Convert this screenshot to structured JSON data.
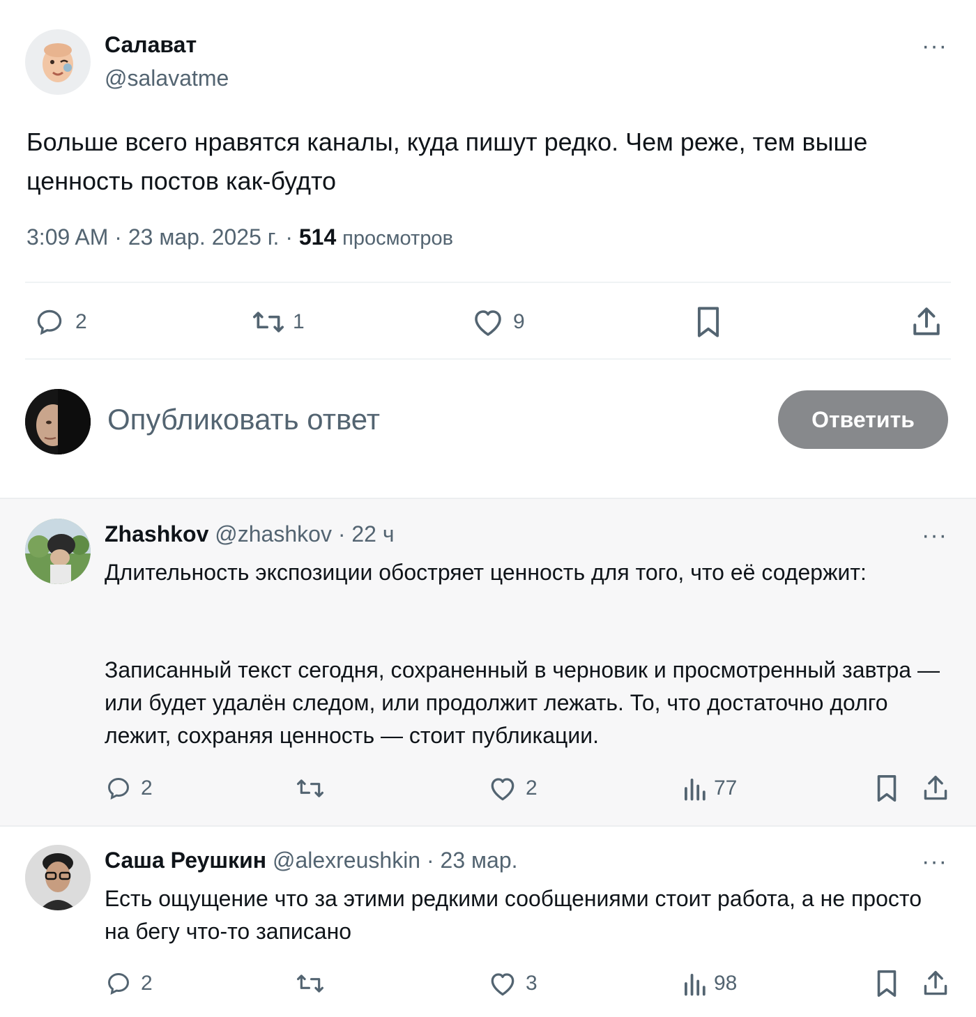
{
  "main_post": {
    "author_name": "Салават",
    "author_handle": "@salavatme",
    "text": "Больше всего нравятся каналы, куда пишут редко. Чем реже, тем выше ценность постов как-будто",
    "time": "3:09 AM · 23 мар. 2025 г. · ",
    "views_count": "514",
    "views_label": "просмотров",
    "actions": {
      "replies": "2",
      "reposts": "1",
      "likes": "9"
    }
  },
  "compose": {
    "placeholder": "Опубликовать ответ",
    "button_label": "Ответить"
  },
  "replies": [
    {
      "author_name": "Zhashkov",
      "author_handle": "@zhashkov",
      "time": "· 22 ч",
      "paragraph1": "Длительность экспозиции обостряет ценность для того, что её содержит:",
      "paragraph2": "Записанный текст сегодня, сохраненный в черновик и просмотренный завтра — или будет удалён следом, или продолжит лежать. То, что достаточно долго лежит, сохраняя ценность — стоит публикации.",
      "replies": "2",
      "likes": "2",
      "views": "77"
    },
    {
      "author_name": "Саша Реушкин",
      "author_handle": "@alexreushkin",
      "time": "· 23 мар.",
      "text": "Есть ощущение что за этими редкими сообщениями стоит работа, а не просто на бегу что-то записано",
      "replies": "2",
      "likes": "3",
      "views": "98"
    }
  ],
  "more_label": "···",
  "colors": {
    "muted": "#536471",
    "button_bg": "#87898c",
    "reply_bg": "#f7f7f8"
  }
}
